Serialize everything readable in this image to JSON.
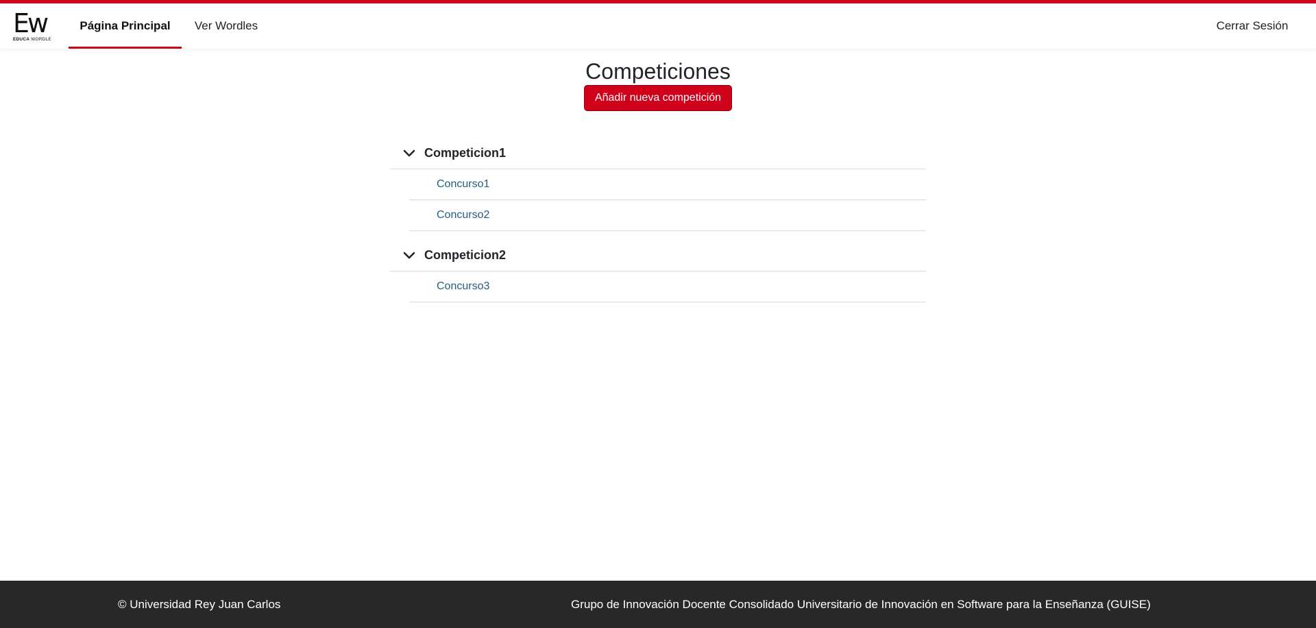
{
  "colors": {
    "accent": "#d0021b",
    "footer_bg": "#282828",
    "link": "#1f5f80"
  },
  "logo": {
    "mark": "Ew",
    "sub_bold": "EDUCA",
    "sub_rest": " WORDLE"
  },
  "nav": {
    "home_label": "Página Principal",
    "wordles_label": "Ver Wordles",
    "logout_label": "Cerrar Sesión"
  },
  "main": {
    "title": "Competiciones",
    "add_button": "Añadir nueva competición",
    "competitions": [
      {
        "name": "Competicion1",
        "icon": "chevron-down-icon",
        "contests": [
          "Concurso1",
          "Concurso2"
        ]
      },
      {
        "name": "Competicion2",
        "icon": "chevron-down-icon",
        "contests": [
          "Concurso3"
        ]
      }
    ]
  },
  "footer": {
    "left": "© Universidad Rey Juan Carlos",
    "right": "Grupo de Innovación Docente Consolidado Universitario de Innovación en Software para la Enseñanza (GUISE)"
  }
}
